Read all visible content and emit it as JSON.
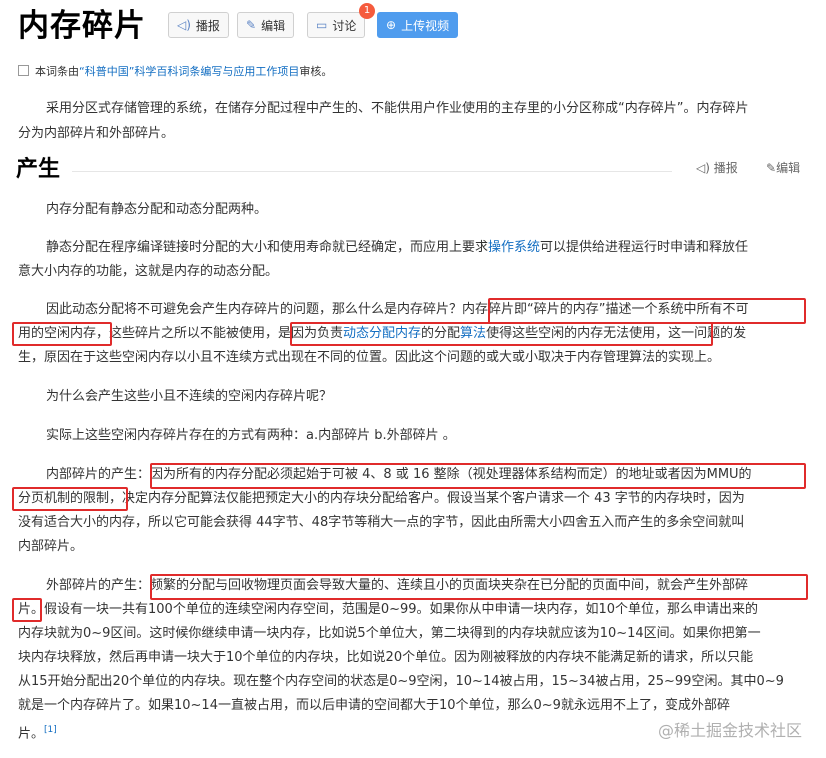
{
  "header": {
    "title": "内存碎片",
    "buttons": {
      "broadcast": "播报",
      "edit": "编辑",
      "discuss": "讨论",
      "upload": "上传视频"
    },
    "discuss_badge": "1"
  },
  "audit": {
    "prefix": "本词条由",
    "org": "“科普中国”科学百科词条编写与应用工作项目",
    "suffix": "审核。"
  },
  "intro": {
    "line1": "采用分区式存储管理的系统，在储存分配过程中产生的、不能供用户作业使用的主存里的小分区称成“内存碎片”。内存碎片",
    "line2": "分为内部碎片和外部碎片。"
  },
  "section": {
    "title": "产生",
    "broadcast": "播报",
    "edit": "编辑"
  },
  "body": {
    "p1": "内存分配有静态分配和动态分配两种。",
    "p2_l1a": "静态分配在程序编译链接时分配的大小和使用寿命就已经确定，而应用上要求",
    "p2_l1_link": "操作系统",
    "p2_l1b": "可以提供给进程运行时申请和释放任",
    "p2_l2": "意大小内存的功能，这就是内存的动态分配。",
    "p3_l1": "因此动态分配将不可避免会产生内存碎片的问题，那么什么是内存碎片？内存碎片即“碎片的内存”描述一个系统中所有不可",
    "p3_l2a": "用的空闲内存，这些碎片之所以不能被使用，是因为负责",
    "p3_l2_link1": "动态分配内存",
    "p3_l2b": "的分配",
    "p3_l2_link2": "算法",
    "p3_l2c": "使得这些空闲的内存无法使用，这一问题的发",
    "p3_l3": "生，原因在于这些空闲内存以小且不连续方式出现在不同的位置。因此这个问题的或大或小取决于内存管理算法的实现上。",
    "p4": "为什么会产生这些小且不连续的空闲内存碎片呢？",
    "p5": "实际上这些空闲内存碎片存在的方式有两种：a.内部碎片 b.外部碎片 。",
    "p6_l1": "内部碎片的产生：因为所有的内存分配必须起始于可被 4、8 或 16 整除（视处理器体系结构而定）的地址或者因为MMU的",
    "p6_l2": "分页机制的限制，决定内存分配算法仅能把预定大小的内存块分配给客户。假设当某个客户请求一个 43 字节的内存块时，因为",
    "p6_l3": "没有适合大小的内存，所以它可能会获得 44字节、48字节等稍大一点的字节，因此由所需大小四舍五入而产生的多余空间就叫",
    "p6_l4": "内部碎片。",
    "p7_l1": "外部碎片的产生：频繁的分配与回收物理页面会导致大量的、连续且小的页面块夹杂在已分配的页面中间，就会产生外部碎",
    "p7_l2": "片。假设有一块一共有100个单位的连续空闲内存空间，范围是0~99。如果你从中申请一块内存，如10个单位，那么申请出来的",
    "p7_l3": "内存块就为0~9区间。这时候你继续申请一块内存，比如说5个单位大，第二块得到的内存块就应该为10~14区间。如果你把第一",
    "p7_l4": "块内存块释放，然后再申请一块大于10个单位的内存块，比如说20个单位。因为刚被释放的内存块不能满足新的请求，所以只能",
    "p7_l5": "从15开始分配出20个单位的内存块。现在整个内存空间的状态是0~9空闲，10~14被占用，15~34被占用，25~99空闲。其中0~9",
    "p7_l6": "就是一个内存碎片了。如果10~14一直被占用，而以后申请的空间都大于10个单位，那么0~9就永远用不上了，变成外部碎",
    "p7_l7": "片。",
    "ref": "[1]"
  },
  "watermark": "@稀土掘金技术社区"
}
